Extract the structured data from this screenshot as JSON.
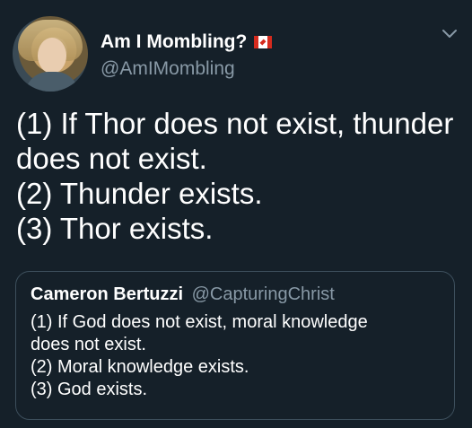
{
  "author": {
    "display_name": "Am I Mombling?",
    "handle": "@AmIMombling",
    "avatar_icon": "profile-photo",
    "flag_icon": "canada-flag-icon"
  },
  "tweet": {
    "lines": [
      "(1) If Thor does not exist, thunder",
      "does not exist.",
      "(2) Thunder exists.",
      "(3) Thor exists."
    ]
  },
  "quoted_tweet": {
    "display_name": "Cameron Bertuzzi",
    "handle": "@CapturingChrist",
    "lines": [
      "(1) If God does not exist, moral knowledge",
      "does not exist.",
      "(2) Moral knowledge exists.",
      "(3) God exists."
    ]
  },
  "menu_icon": "chevron-down-icon",
  "colors": {
    "background": "#152029",
    "text": "#ffffff",
    "secondary_text": "#8899a6",
    "border": "#3d4f5c"
  }
}
